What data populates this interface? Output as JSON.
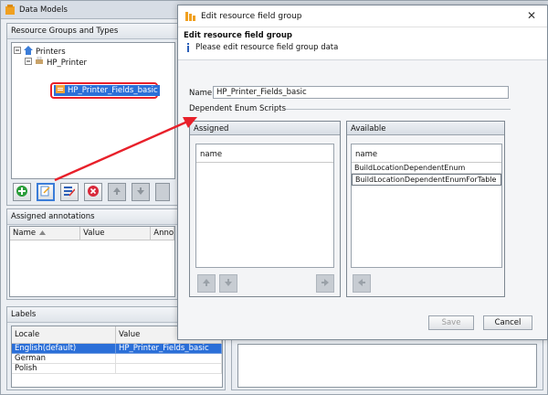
{
  "main_window": {
    "title": "Data Models",
    "resource_section": {
      "title": "Resource Groups and Types",
      "tree": [
        {
          "label": "Printers"
        },
        {
          "label": "HP_Printer"
        },
        {
          "label": "HP_Printer_Fields_basic"
        }
      ]
    },
    "annotations": {
      "title": "Assigned annotations",
      "columns": [
        "Name",
        "Value",
        "Annota"
      ]
    },
    "labels": {
      "title": "Labels",
      "columns": [
        "Locale",
        "Value"
      ],
      "rows": [
        {
          "locale": "English(default)",
          "value": "HP_Printer_Fields_basic"
        },
        {
          "locale": "German",
          "value": ""
        },
        {
          "locale": "Polish",
          "value": ""
        }
      ]
    }
  },
  "dialog": {
    "title": "Edit resource field group",
    "header_title": "Edit resource field group",
    "header_info": "Please edit resource field group data",
    "name_label": "Name:",
    "name_value": "HP_Printer_Fields_basic",
    "enum_section_label": "Dependent Enum Scripts",
    "assigned": {
      "title": "Assigned",
      "column": "name",
      "items": []
    },
    "available": {
      "title": "Available",
      "column": "name",
      "items": [
        "BuildLocationDependentEnum",
        "BuildLocationDependentEnumForTable"
      ]
    },
    "save_label": "Save",
    "cancel_label": "Cancel"
  },
  "colors": {
    "selection": "#2b6fd8",
    "annotation_red": "#e8202a",
    "title_icon_orange": "#f0a020"
  },
  "icons": [
    "data-models-icon",
    "house-icon",
    "printer-icon",
    "field-group-icon",
    "add-icon",
    "edit-icon",
    "edit-list-icon",
    "delete-icon",
    "move-up-icon",
    "move-down-icon",
    "arrow-right-icon",
    "arrow-left-icon",
    "info-icon",
    "close-icon",
    "sort-asc-icon",
    "collapse-icon",
    "pointer-arrow"
  ]
}
